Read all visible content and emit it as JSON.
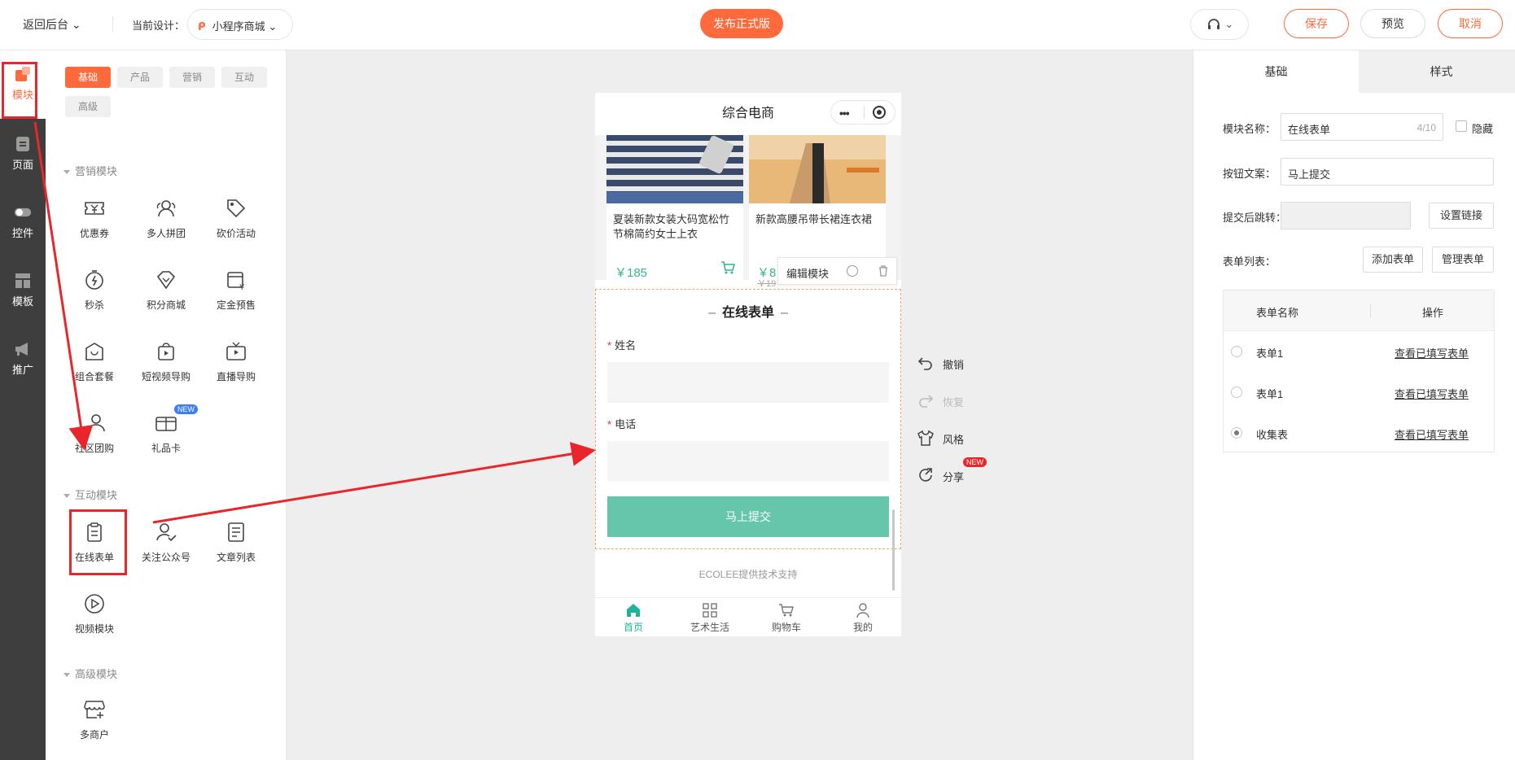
{
  "topbar": {
    "back_label": "返回后台",
    "design_label": "当前设计：",
    "design_value": "小程序商城",
    "publish_label": "发布正式版",
    "save_label": "保存",
    "preview_label": "预览",
    "cancel_label": "取消"
  },
  "rail": {
    "items": [
      {
        "label": "模块",
        "icon": "module-icon"
      },
      {
        "label": "页面",
        "icon": "page-icon"
      },
      {
        "label": "控件",
        "icon": "toggle-icon"
      },
      {
        "label": "模板",
        "icon": "template-icon"
      },
      {
        "label": "推广",
        "icon": "megaphone-icon"
      }
    ]
  },
  "module_panel": {
    "tabs": [
      "基础",
      "产品",
      "营销",
      "互动",
      "高级"
    ],
    "sections": {
      "marketing": "营销模块",
      "interactive": "互动模块",
      "advanced": "高级模块"
    },
    "marketing_items": [
      "优惠券",
      "多人拼团",
      "砍价活动",
      "秒杀",
      "积分商城",
      "定金预售",
      "组合套餐",
      "短视频导购",
      "直播导购",
      "社区团购",
      "礼品卡"
    ],
    "new_badge": "NEW",
    "interactive_items": [
      "在线表单",
      "关注公众号",
      "文章列表",
      "视频模块"
    ],
    "advanced_items": [
      "多商户"
    ]
  },
  "phone": {
    "title": "综合电商",
    "products": [
      {
        "name": "夏装新款女装大码宽松竹节棉简约女士上衣",
        "price": "￥185"
      },
      {
        "name": "新款高腰吊带长裙连衣裙",
        "price": "￥8",
        "old_price": "￥19"
      }
    ],
    "edit_bar_label": "编辑模块",
    "form": {
      "title": "在线表单",
      "field1_label": "姓名",
      "field2_label": "电话",
      "required_mark": "*",
      "submit_label": "马上提交"
    },
    "footer_text": "ECOLEE提供技术支持",
    "tabbar": [
      "首页",
      "艺术生活",
      "购物车",
      "我的"
    ]
  },
  "side_tools": {
    "undo": "撤销",
    "redo": "恢复",
    "style": "风格",
    "share": "分享",
    "new_badge": "NEW"
  },
  "right_panel": {
    "tabs": [
      "基础",
      "样式"
    ],
    "module_name_label": "模块名称：",
    "module_name_value": "在线表单",
    "module_name_count": "4/10",
    "hide_label": "隐藏",
    "button_text_label": "按钮文案：",
    "button_text_value": "马上提交",
    "redirect_label": "提交后跳转：",
    "set_link_label": "设置链接",
    "form_list_label": "表单列表：",
    "add_form_label": "添加表单",
    "manage_form_label": "管理表单",
    "table_headers": [
      "表单名称",
      "操作"
    ],
    "table_rows": [
      {
        "name": "表单1",
        "action": "查看已填写表单",
        "selected": false
      },
      {
        "name": "表单1",
        "action": "查看已填写表单",
        "selected": false
      },
      {
        "name": "收集表",
        "action": "查看已填写表单",
        "selected": true
      }
    ]
  },
  "colors": {
    "accent": "#ff6a3d",
    "submit": "#65c6ab",
    "highlight": "#e8262c",
    "tab_active": "#20b39b"
  }
}
